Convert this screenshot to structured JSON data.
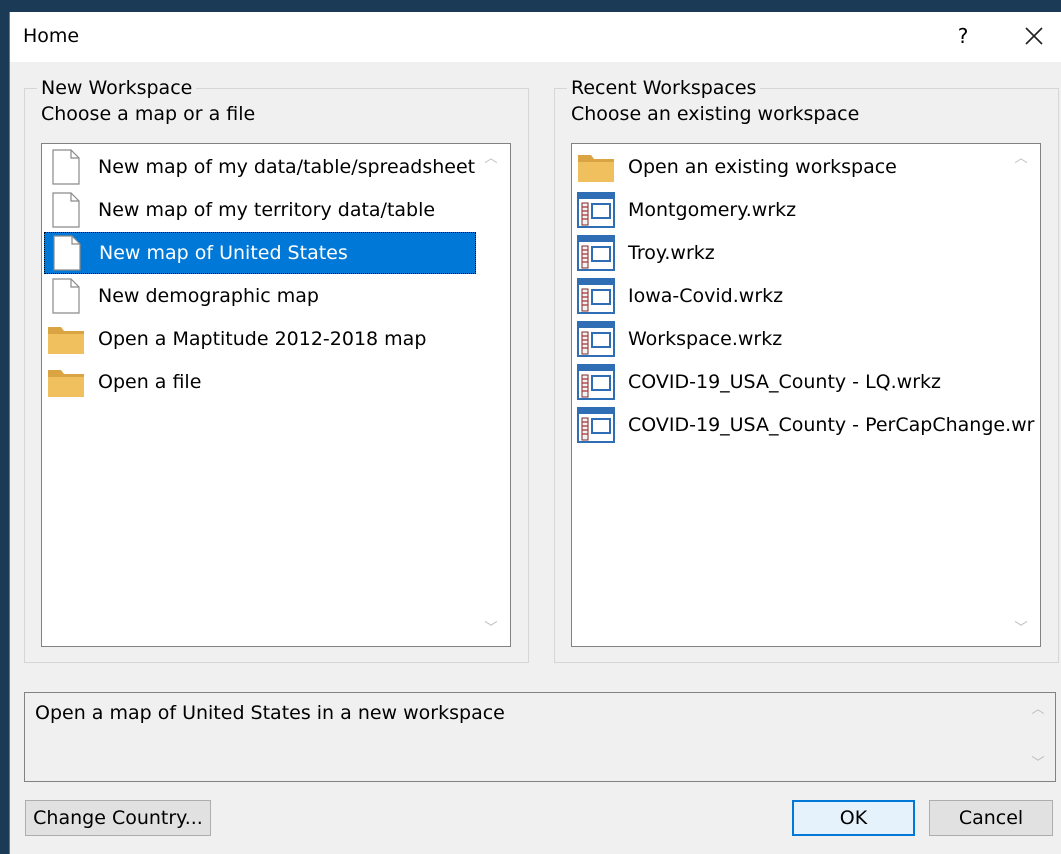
{
  "window": {
    "title": "Home",
    "help_glyph": "?",
    "close_icon": "close-icon"
  },
  "new_workspace": {
    "title": "New Workspace",
    "subtitle": "Choose a map or a file",
    "items": [
      {
        "label": "New map of my data/table/spreadsheet",
        "icon": "document-icon"
      },
      {
        "label": "New map of my territory data/table",
        "icon": "document-icon"
      },
      {
        "label": "New map of United States",
        "icon": "document-icon",
        "selected": true
      },
      {
        "label": "New demographic map",
        "icon": "document-icon"
      },
      {
        "label": "Open a Maptitude 2012-2018 map",
        "icon": "folder-icon"
      },
      {
        "label": "Open a file",
        "icon": "folder-icon"
      }
    ]
  },
  "recent_workspaces": {
    "title": "Recent Workspaces",
    "subtitle": "Choose an existing workspace",
    "items": [
      {
        "label": "Open an existing workspace",
        "icon": "folder-icon"
      },
      {
        "label": "Montgomery.wrkz",
        "icon": "workspace-file-icon"
      },
      {
        "label": "Troy.wrkz",
        "icon": "workspace-file-icon"
      },
      {
        "label": "Iowa-Covid.wrkz",
        "icon": "workspace-file-icon"
      },
      {
        "label": "Workspace.wrkz",
        "icon": "workspace-file-icon"
      },
      {
        "label": "COVID-19_USA_County - LQ.wrkz",
        "icon": "workspace-file-icon"
      },
      {
        "label": "COVID-19_USA_County - PerCapChange.wr",
        "icon": "workspace-file-icon"
      }
    ]
  },
  "description": {
    "text": "Open a map of United States in a new workspace"
  },
  "buttons": {
    "change_country": "Change Country...",
    "ok": "OK",
    "cancel": "Cancel"
  },
  "colors": {
    "selection": "#0078d7",
    "dialog_bg": "#f0f0f0",
    "desktop_bg": "#1a3a56",
    "folder": "#e8b350"
  }
}
